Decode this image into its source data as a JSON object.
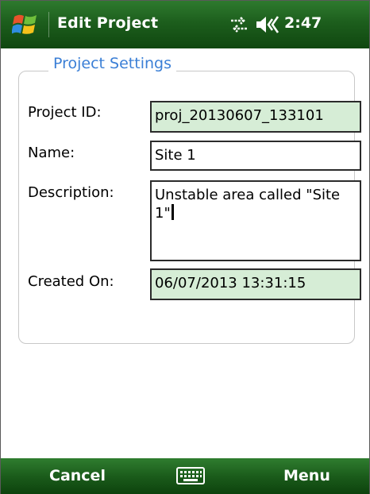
{
  "titlebar": {
    "title": "Edit Project",
    "clock": "2:47",
    "start_icon": "windows-flag-icon",
    "data_icon": "data-connection-icon",
    "volume_icon": "speaker-icon"
  },
  "group": {
    "legend": "Project Settings"
  },
  "fields": {
    "project_id_label": "Project ID:",
    "project_id_value": "proj_20130607_133101",
    "name_label": "Name:",
    "name_value": "Site 1",
    "description_label": "Description:",
    "description_value": "Unstable area called \"Site 1\"",
    "created_label": "Created On:",
    "created_value": "06/07/2013 13:31:15"
  },
  "softkeys": {
    "left": "Cancel",
    "right": "Menu",
    "center_icon": "keyboard-icon"
  },
  "colors": {
    "titlebar": "#1d5e1d",
    "legend": "#3b7fd6",
    "readonly_field": "#d6edd6"
  }
}
